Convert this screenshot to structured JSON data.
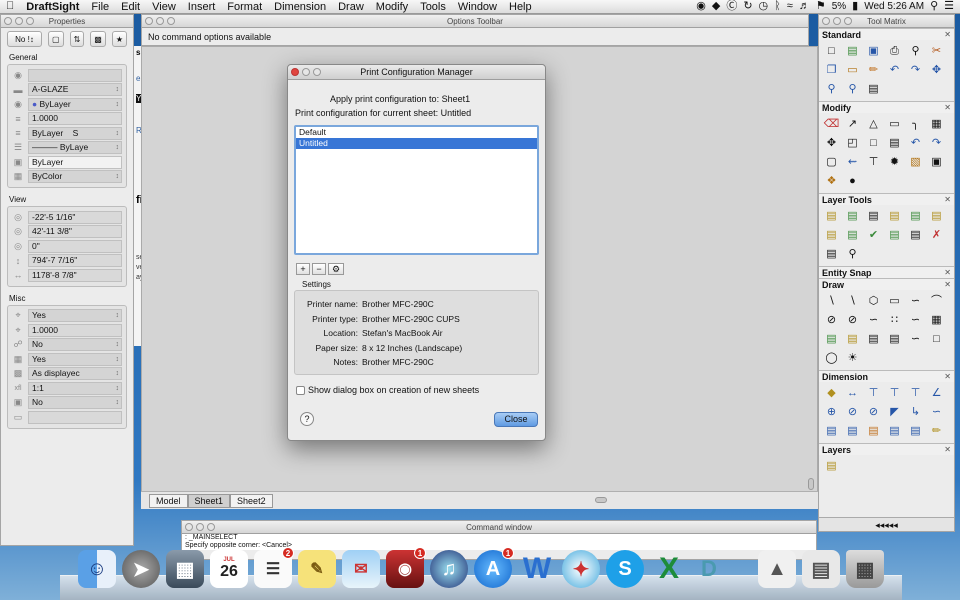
{
  "menubar": {
    "app_name": "DraftSight",
    "items": [
      "File",
      "Edit",
      "View",
      "Insert",
      "Format",
      "Dimension",
      "Draw",
      "Modify",
      "Tools",
      "Window",
      "Help"
    ],
    "battery": "5%",
    "clock": "Wed 5:26 AM"
  },
  "properties": {
    "title": "Properties",
    "toolbar_select": "No !",
    "general": {
      "label": "General",
      "rows": [
        "",
        "A-GLAZE",
        "ByLayer",
        "1.0000",
        "ByLayer",
        "ByLaye",
        "ByLayer",
        "ByColor"
      ],
      "row2_suffix": "S"
    },
    "view": {
      "label": "View",
      "rows": [
        "-22'-5 1/16\"",
        "42'-11 3/8\"",
        "0\"",
        "794'-7 7/16\"",
        "1178'-8 7/8\""
      ]
    },
    "misc": {
      "label": "Misc",
      "rows": [
        "Yes",
        "1.0000",
        "No",
        "Yes",
        "As displayec",
        "1:1",
        "No",
        ""
      ],
      "xfl_label": "xfl"
    }
  },
  "options_toolbar": {
    "title": "Options Toolbar",
    "message": "No command options available"
  },
  "drawing": {
    "tabs": [
      "Model",
      "Sheet1",
      "Sheet2"
    ],
    "active_tab": "Sheet1",
    "left_strip": [
      "s",
      "e A",
      "Y",
      "RT",
      "fig",
      "setu",
      "vers",
      "ays"
    ]
  },
  "dialog": {
    "title": "Print Configuration Manager",
    "apply_label": "Apply print configuration to:",
    "apply_value": "Sheet1",
    "current_label": "Print configuration for current sheet:",
    "current_value": "Untitled",
    "list": [
      "Default",
      "Untitled"
    ],
    "selected": "Untitled",
    "buttons": {
      "add": "+",
      "remove": "−",
      "options": "⚙"
    },
    "settings_label": "Settings",
    "settings": [
      {
        "k": "Printer name:",
        "v": "Brother MFC-290C"
      },
      {
        "k": "Printer type:",
        "v": "Brother MFC-290C CUPS"
      },
      {
        "k": "Location:",
        "v": "Stefan's MacBook Air"
      },
      {
        "k": "Paper size:",
        "v": "8 x 12 Inches (Landscape)"
      },
      {
        "k": "Notes:",
        "v": "Brother MFC-290C"
      }
    ],
    "checkbox_label": "Show dialog box on creation of new sheets",
    "help": "?",
    "close": "Close"
  },
  "tool_matrix": {
    "title": "Tool Matrix",
    "sections": [
      "Standard",
      "Modify",
      "Layer Tools",
      "Entity Snap",
      "Draw",
      "Dimension",
      "Layers"
    ],
    "footer": "◂◂◂◂◂"
  },
  "command_window": {
    "title": "Command window",
    "lines": [
      ": _MAINSELECT",
      "Specify opposite corner: <Cancel>"
    ]
  },
  "dock": {
    "calendar_month": "JUL",
    "calendar_day": "26",
    "badges": {
      "reminders": "2",
      "photo_booth": "1",
      "app_store": "1"
    }
  },
  "colors": {
    "accent": "#3876d6",
    "close_button": "#5f9ae2",
    "badge": "#d62b22"
  }
}
